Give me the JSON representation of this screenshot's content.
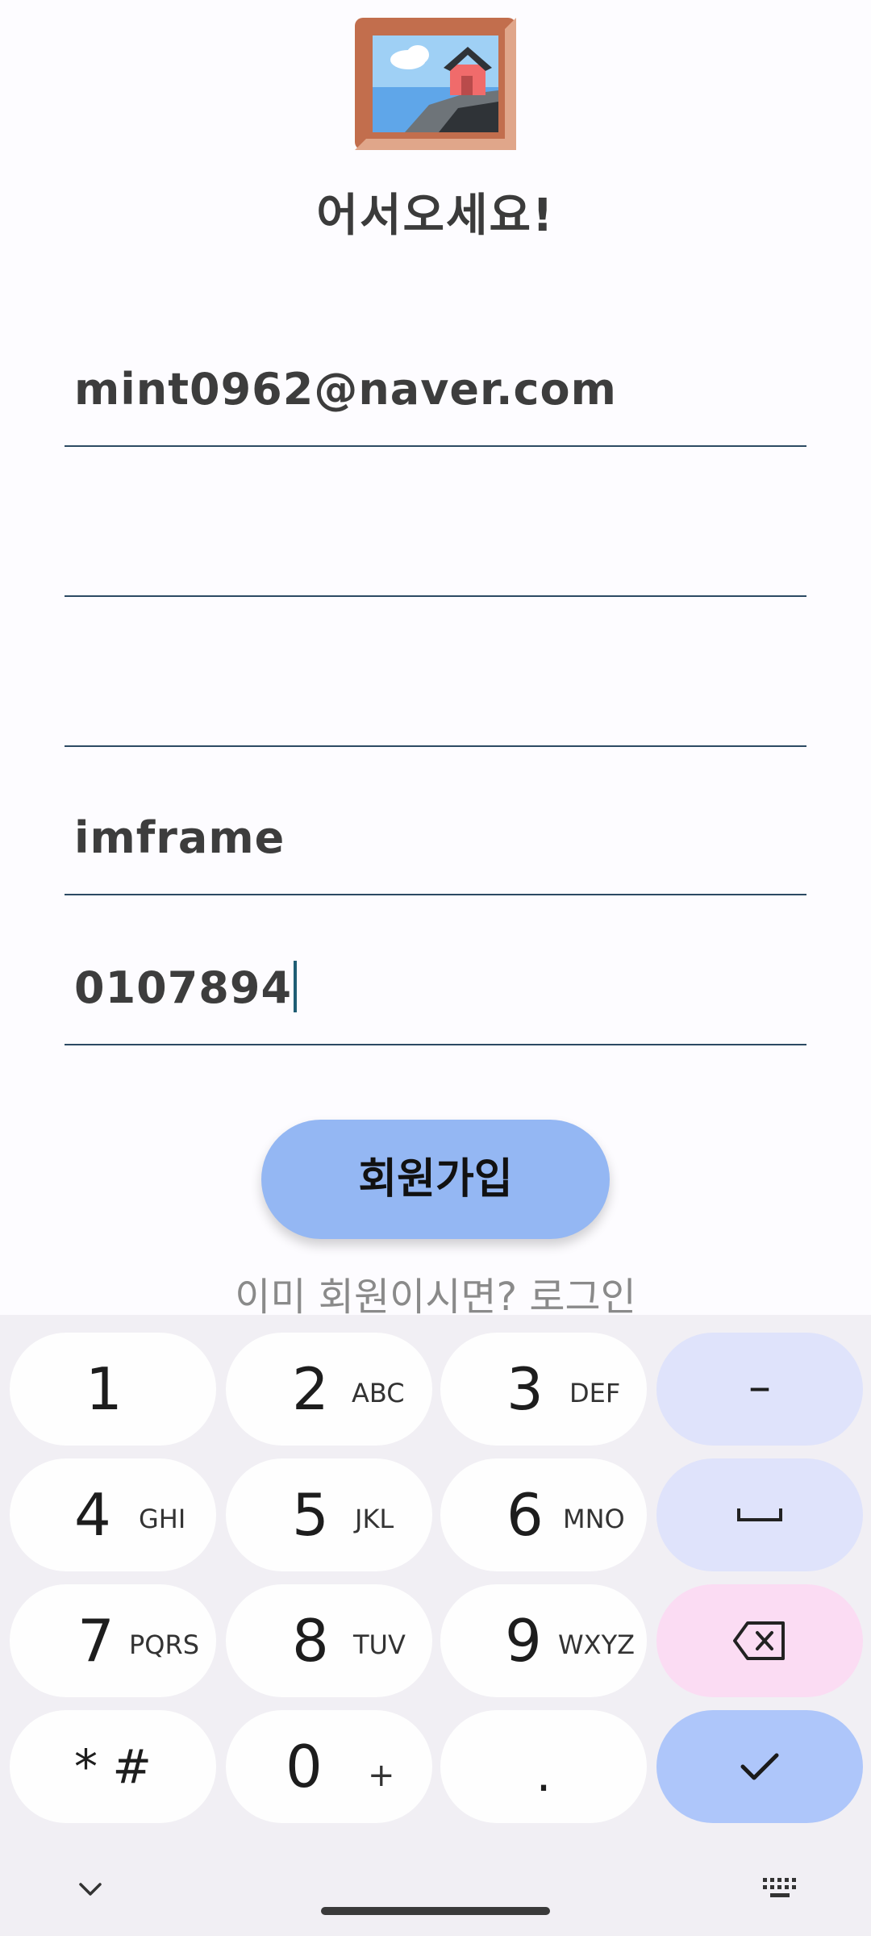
{
  "header": {
    "title": "어서오세요!"
  },
  "form": {
    "email_value": "mint0962@naver.com",
    "field2_value": "",
    "field3_value": "",
    "field4_value": "imframe",
    "phone_value": "0107894"
  },
  "actions": {
    "signup_label": "회원가입",
    "login_link": "이미 회원이시면? 로그인"
  },
  "keyboard": {
    "keys": [
      {
        "digit": "1",
        "letters": ""
      },
      {
        "digit": "2",
        "letters": "ABC"
      },
      {
        "digit": "3",
        "letters": "DEF"
      },
      {
        "digit": "4",
        "letters": "GHI"
      },
      {
        "digit": "5",
        "letters": "JKL"
      },
      {
        "digit": "6",
        "letters": "MNO"
      },
      {
        "digit": "7",
        "letters": "PQRS"
      },
      {
        "digit": "8",
        "letters": "TUV"
      },
      {
        "digit": "9",
        "letters": "WXYZ"
      },
      {
        "digit": "0",
        "letters": "+"
      }
    ],
    "special": {
      "star_hash": "* #",
      "dot": ".",
      "dash": "–"
    },
    "icons": [
      "space-icon",
      "backspace-icon",
      "check-icon",
      "chevron-down-icon",
      "keyboard-icon"
    ]
  },
  "colors": {
    "signup_button": "#94b7f3",
    "function_key": "#dfe3fb",
    "backspace_key": "#fbdcf3",
    "enter_key": "#aec6fa"
  }
}
